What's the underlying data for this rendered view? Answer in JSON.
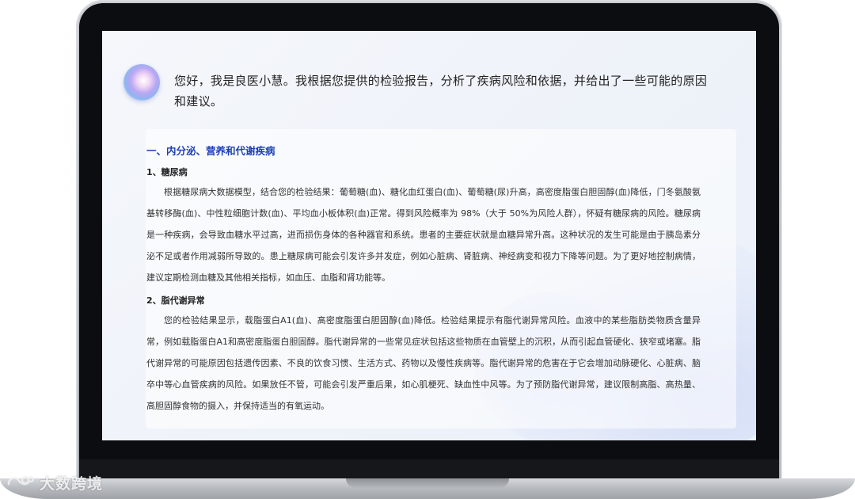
{
  "assistant": {
    "greeting": "您好，我是良医小慧。我根据您提供的检验报告，分析了疾病风险和依据，并给出了一些可能的原因和建议。",
    "avatar_icon": "assistant-orb-icon"
  },
  "report": {
    "section_title": "一、内分泌、营养和代谢疾病",
    "items": [
      {
        "title": "1、糖尿病",
        "text": "根据糖尿病大数据模型，结合您的检验结果：葡萄糖(血)、糖化血红蛋白(血)、葡萄糖(尿)升高，高密度脂蛋白胆固醇(血)降低，门冬氨酸氨基转移酶(血)、中性粒细胞计数(血)、平均血小板体积(血)正常。得到风险概率为 98%（大于 50%为风险人群），怀疑有糖尿病的风险。糖尿病是一种疾病，会导致血糖水平过高，进而损伤身体的各种器官和系统。患者的主要症状就是血糖异常升高。这种状况的发生可能是由于胰岛素分泌不足或者作用减弱所导致的。患上糖尿病可能会引发许多并发症，例如心脏病、肾脏病、神经病变和视力下降等问题。为了更好地控制病情，建议定期检测血糖及其他相关指标，如血压、血脂和肾功能等。"
      },
      {
        "title": "2、脂代谢异常",
        "text": "您的检验结果显示，载脂蛋白A1(血)、高密度脂蛋白胆固醇(血)降低。检验结果提示有脂代谢异常风险。血液中的某些脂肪类物质含量异常，例如载脂蛋白A1和高密度脂蛋白胆固醇。脂代谢异常的一些常见症状包括这些物质在血管壁上的沉积，从而引起血管硬化、狭窄或堵塞。脂代谢异常的可能原因包括遗传因素、不良的饮食习惯、生活方式、药物以及慢性疾病等。脂代谢异常的危害在于它会增加动脉硬化、心脏病、脑卒中等心血管疾病的风险。如果放任不管，可能会引发严重后果，如心肌梗死、缺血性中风等。为了预防脂代谢异常，建议限制高脂、高热量、高胆固醇食物的摄入，并保持适当的有氧运动。"
      }
    ]
  },
  "watermark": {
    "text": "大数跨境",
    "icon": "brand-logo-icon"
  }
}
